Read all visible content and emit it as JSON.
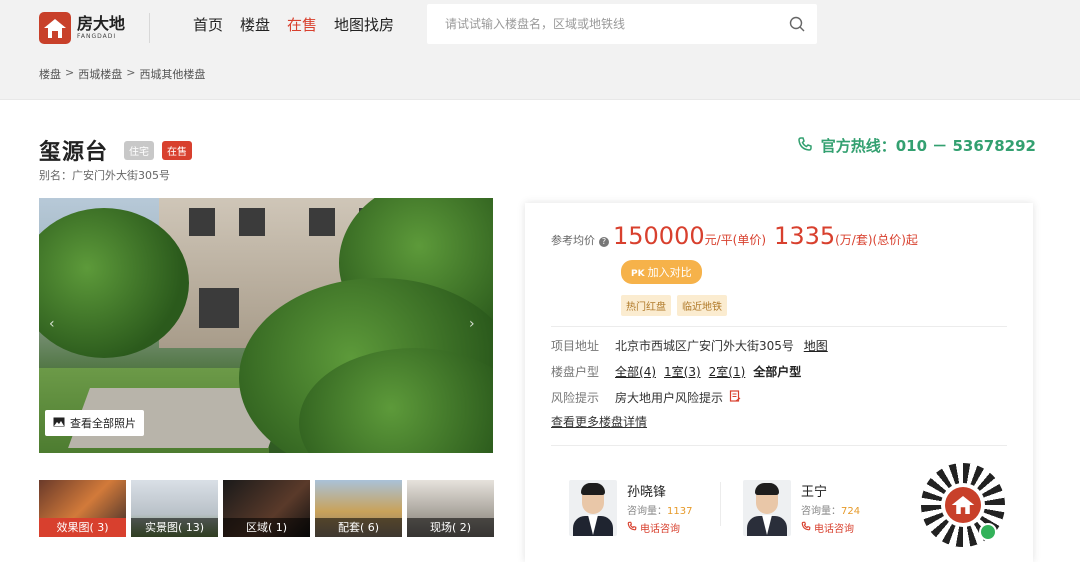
{
  "brand": {
    "name_cn": "房大地",
    "name_en": "FANGDADI",
    "color": "#c8402a"
  },
  "nav": [
    {
      "label": "首页"
    },
    {
      "label": "楼盘"
    },
    {
      "label": "在售",
      "active": true
    },
    {
      "label": "地图找房"
    }
  ],
  "search": {
    "placeholder": "请试试输入楼盘名，区域或地铁线"
  },
  "breadcrumb": [
    "楼盘",
    "西城楼盘",
    "西城其他楼盘"
  ],
  "breadcrumb_sep": ">",
  "property": {
    "title": "玺源台",
    "tag_type": "住宅",
    "tag_status": "在售",
    "alias": "别名：广安门外大街305号"
  },
  "hotline": {
    "label": "官方热线：010 － 53678292"
  },
  "gallery": {
    "view_all": "查看全部照片",
    "thumbs": [
      {
        "label": "效果图( 3)",
        "active": true
      },
      {
        "label": "实景图( 13)"
      },
      {
        "label": "区域( 1)"
      },
      {
        "label": "配套( 6)"
      },
      {
        "label": "现场( 2)"
      }
    ]
  },
  "price": {
    "label": "参考均价",
    "help": "?",
    "unit_price": "150000",
    "unit_price_suffix": "元/平(单价)",
    "total_price": "1335",
    "total_price_suffix": "(万/套)(总价)起"
  },
  "pk": {
    "badge": "PK",
    "label": "加入对比"
  },
  "features": [
    "热门红盘",
    "临近地铁"
  ],
  "info": {
    "address_key": "项目地址",
    "address": "北京市西城区广安门外大街305号",
    "map_link": "地图",
    "layout_key": "楼盘户型",
    "layouts": [
      "全部(4)",
      "1室(3)",
      "2室(1)"
    ],
    "layouts_all": "全部户型",
    "risk_key": "风险提示",
    "risk": "房大地用户风险提示",
    "more": "查看更多楼盘详情"
  },
  "agents": [
    {
      "name": "孙晓锋",
      "count_label": "咨询量：",
      "count": "1137",
      "call": "电话咨询"
    },
    {
      "name": "王宁",
      "count_label": "咨询量：",
      "count": "724",
      "call": "电话咨询"
    }
  ],
  "colors": {
    "accent": "#d8402e",
    "hotline": "#33a070"
  }
}
